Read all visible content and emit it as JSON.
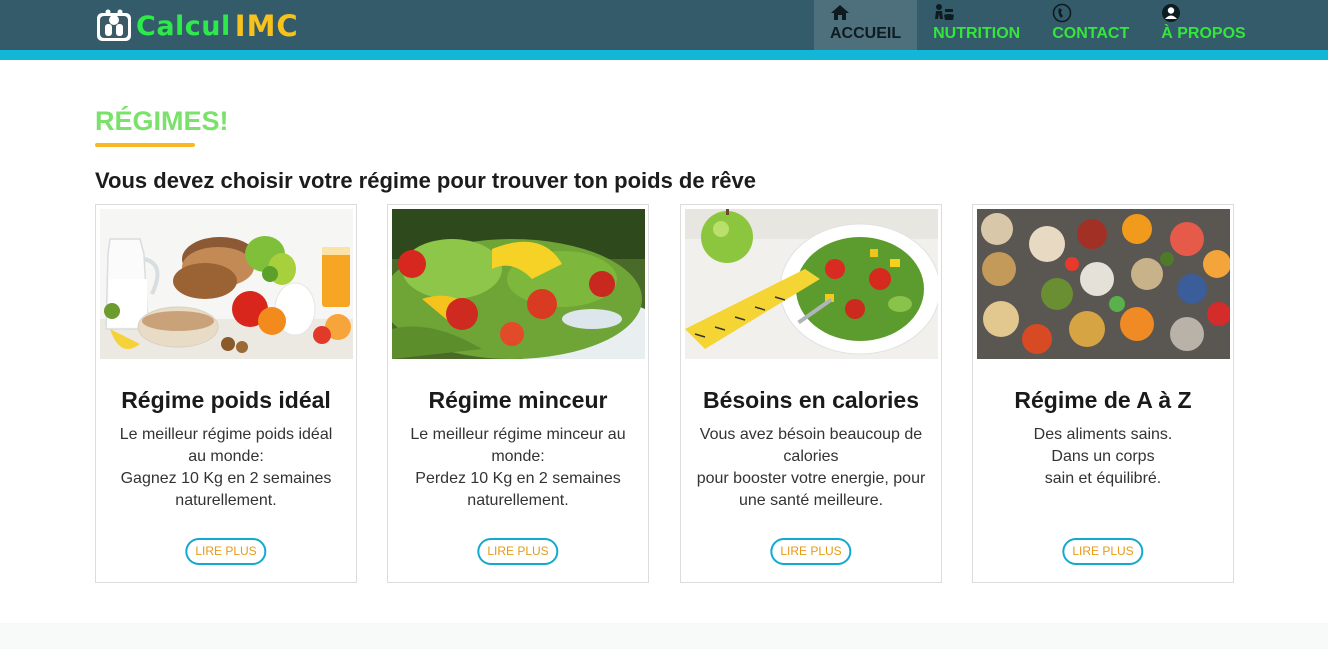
{
  "header": {
    "logo_text_1": "Calcul",
    "logo_text_2": "IMC",
    "nav": [
      {
        "label": "ACCUEIL",
        "icon": "home-icon",
        "active": true
      },
      {
        "label": "NUTRITION",
        "icon": "nutrition-icon",
        "active": false
      },
      {
        "label": "CONTACT",
        "icon": "phone-icon",
        "active": false
      },
      {
        "label": "À PROPOS",
        "icon": "user-icon",
        "active": false
      }
    ]
  },
  "main": {
    "title": "RÉGIMES!",
    "subtitle": "Vous devez choisir votre régime pour trouver ton poids de rêve",
    "cards": [
      {
        "title": "Régime poids idéal",
        "lines": [
          "Le meilleur régime poids idéal",
          "au monde:",
          "Gagnez 10 Kg en 2 semaines",
          "naturellement."
        ],
        "button": "LIRE PLUS",
        "image": "breakfast-photo"
      },
      {
        "title": "Régime minceur",
        "lines": [
          "Le meilleur régime minceur au",
          "monde:",
          "Perdez 10 Kg en 2 semaines",
          "naturellement."
        ],
        "button": "LIRE PLUS",
        "image": "salad-photo"
      },
      {
        "title": "Bésoins en calories",
        "lines": [
          "Vous avez bésoin beaucoup de",
          "calories",
          "pour booster votre energie, pour",
          "une santé meilleure."
        ],
        "button": "LIRE PLUS",
        "image": "salad-tape-photo"
      },
      {
        "title": "Régime de A à Z",
        "lines": [
          "Des aliments sains.",
          "Dans un corps",
          "sain et équilibré."
        ],
        "button": "LIRE PLUS",
        "image": "healthy-food-photo"
      }
    ]
  },
  "colors": {
    "header_bg": "#345b6a",
    "header_stripe": "#12b6d6",
    "nav_text": "#34e63a",
    "title_green": "#7ae26a",
    "accent_orange": "#f7b824",
    "button_border": "#14a9cf",
    "button_text": "#e69a16"
  }
}
